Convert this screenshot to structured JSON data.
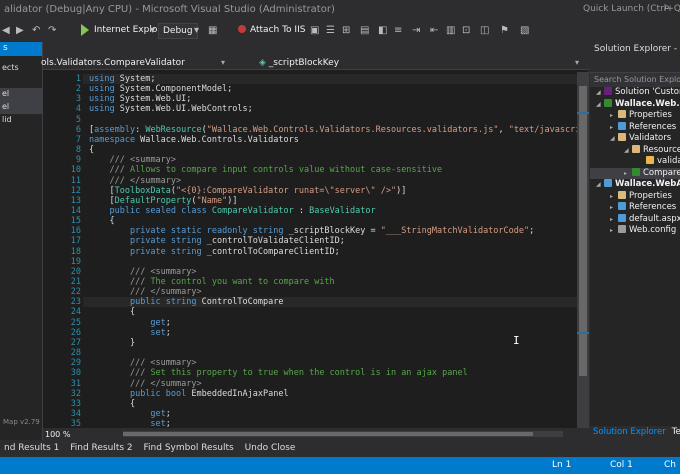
{
  "window": {
    "title": "alidator (Debug|Any CPU) - Microsoft Visual Studio (Administrator)",
    "quick_launch": "Quick Launch (Ctrl+Q)"
  },
  "toolbar": {
    "browser": "Internet Explorer",
    "config": "Debug",
    "attach": "Attach To IIS"
  },
  "left_pane": {
    "tab": "s",
    "items": [
      "ects",
      "",
      "el",
      "el",
      "lid",
      "",
      ""
    ],
    "footer": "Map v2.79"
  },
  "editor": {
    "nav_left": "ols.Validators.CompareValidator",
    "nav_right": "_scriptBlockKey",
    "zoom": "100 %",
    "lines": [
      {
        "n": "1",
        "html": "<span class=\"kw\">using</span> System;"
      },
      {
        "n": "2",
        "html": "<span class=\"kw\">using</span> System.ComponentModel;"
      },
      {
        "n": "3",
        "html": "<span class=\"kw\">using</span> System.Web.UI;"
      },
      {
        "n": "4",
        "html": "<span class=\"kw\">using</span> System.Web.UI.WebControls;"
      },
      {
        "n": "5",
        "html": ""
      },
      {
        "n": "6",
        "html": "[<span class=\"kw\">assembly</span>: <span class=\"ty\">WebResource</span>(<span class=\"st\">\"Wallace.Web.Controls.Validators.Resources.validators.js\"</span>, <span class=\"st\">\"text/javascript\"</span>)]"
      },
      {
        "n": "7",
        "html": "<span class=\"kw\">namespace</span> Wallace.Web.Controls.Validators"
      },
      {
        "n": "8",
        "html": "{"
      },
      {
        "n": "9",
        "html": "    <span class=\"gray\">///</span> <span class=\"gray\">&lt;summary&gt;</span>"
      },
      {
        "n": "10",
        "html": "    <span class=\"gray\">///</span> <span class=\"cm\">Allows to compare input controls value without case-sensitive</span>"
      },
      {
        "n": "11",
        "html": "    <span class=\"gray\">/// &lt;/summary&gt;</span>"
      },
      {
        "n": "12",
        "html": "    [<span class=\"ty\">ToolboxData</span>(<span class=\"st\">\"&lt;{0}:CompareValidator runat=\\\"server\\\" /&gt;\"</span>)]"
      },
      {
        "n": "13",
        "html": "    [<span class=\"ty\">DefaultProperty</span>(<span class=\"st\">\"Name\"</span>)]"
      },
      {
        "n": "14",
        "html": "    <span class=\"kw\">public sealed class</span> <span class=\"ty\">CompareValidator</span> : <span class=\"ty\">BaseValidator</span>"
      },
      {
        "n": "15",
        "html": "    {"
      },
      {
        "n": "16",
        "html": "        <span class=\"kw\">private static readonly string</span> _scriptBlockKey = <span class=\"st\">\"___StringMatchValidatorCode\"</span>;"
      },
      {
        "n": "17",
        "html": "        <span class=\"kw\">private string</span> _controlToValidateClientID;"
      },
      {
        "n": "18",
        "html": "        <span class=\"kw\">private string</span> _controlToCompareClientID;"
      },
      {
        "n": "19",
        "html": ""
      },
      {
        "n": "20",
        "html": "        <span class=\"gray\">/// &lt;summary&gt;</span>"
      },
      {
        "n": "21",
        "html": "        <span class=\"gray\">///</span> <span class=\"cm\">The control you want to compare with</span>"
      },
      {
        "n": "22",
        "html": "        <span class=\"gray\">/// &lt;/summary&gt;</span>"
      },
      {
        "n": "23",
        "html": "        <span class=\"kw\">public string</span> ControlToCompare"
      },
      {
        "n": "24",
        "html": "        {"
      },
      {
        "n": "25",
        "html": "            <span class=\"kw\">get</span>;"
      },
      {
        "n": "26",
        "html": "            <span class=\"kw\">set</span>;"
      },
      {
        "n": "27",
        "html": "        }"
      },
      {
        "n": "28",
        "html": ""
      },
      {
        "n": "29",
        "html": "        <span class=\"gray\">/// &lt;summary&gt;</span>"
      },
      {
        "n": "30",
        "html": "        <span class=\"gray\">///</span> <span class=\"cm\">Set this property to true when the control is in an ajax panel</span>"
      },
      {
        "n": "31",
        "html": "        <span class=\"gray\">/// &lt;/summary&gt;</span>"
      },
      {
        "n": "32",
        "html": "        <span class=\"kw\">public bool</span> EmbeddedInAjaxPanel"
      },
      {
        "n": "33",
        "html": "        {"
      },
      {
        "n": "34",
        "html": "            <span class=\"kw\">get</span>;"
      },
      {
        "n": "35",
        "html": "            <span class=\"kw\">set</span>;"
      }
    ]
  },
  "solution_explorer": {
    "title": "Solution Explorer - Custo",
    "search": "Search Solution Explorer",
    "items": [
      {
        "label": "Solution 'CustomC",
        "icon": "solution-icon",
        "color": "#68217a",
        "bold": false
      },
      {
        "label": "Wallace.Web.Co",
        "icon": "csharp-project-icon",
        "color": "#368832",
        "bold": true
      },
      {
        "label": "Properties",
        "icon": "properties-icon",
        "color": "#d7ba7d",
        "bold": false
      },
      {
        "label": "References",
        "icon": "references-icon",
        "color": "#4e9cd6",
        "bold": false
      },
      {
        "label": "Validators",
        "icon": "folder-icon",
        "color": "#dcb67a",
        "bold": false
      },
      {
        "label": "Resource",
        "icon": "folder-icon",
        "color": "#dcb67a",
        "bold": false
      },
      {
        "label": "valida",
        "icon": "javascript-file-icon",
        "color": "#e8b74b",
        "bold": false
      },
      {
        "label": "Compare",
        "icon": "csharp-file-icon",
        "color": "#368832",
        "bold": false
      },
      {
        "label": "Wallace.WebAp",
        "icon": "web-project-icon",
        "color": "#4e9cd6",
        "bold": true
      },
      {
        "label": "Properties",
        "icon": "properties-icon",
        "color": "#d7ba7d",
        "bold": false
      },
      {
        "label": "References",
        "icon": "references-icon",
        "color": "#4e9cd6",
        "bold": false
      },
      {
        "label": "default.aspx",
        "icon": "aspx-file-icon",
        "color": "#4e9cd6",
        "bold": false
      },
      {
        "label": "Web.config",
        "icon": "config-file-icon",
        "color": "#9b9b9b",
        "bold": false
      }
    ],
    "tab_active": "Solution Explorer",
    "tab_other": "Team"
  },
  "bottom_tabs": [
    "nd Results 1",
    "Find Results 2",
    "Find Symbol Results",
    "Undo Close"
  ],
  "status": {
    "line": "Ln 1",
    "col": "Col 1",
    "ch": "Ch"
  },
  "colors": {
    "accent": "#007acc",
    "editor_bg": "#1e1e1e"
  }
}
